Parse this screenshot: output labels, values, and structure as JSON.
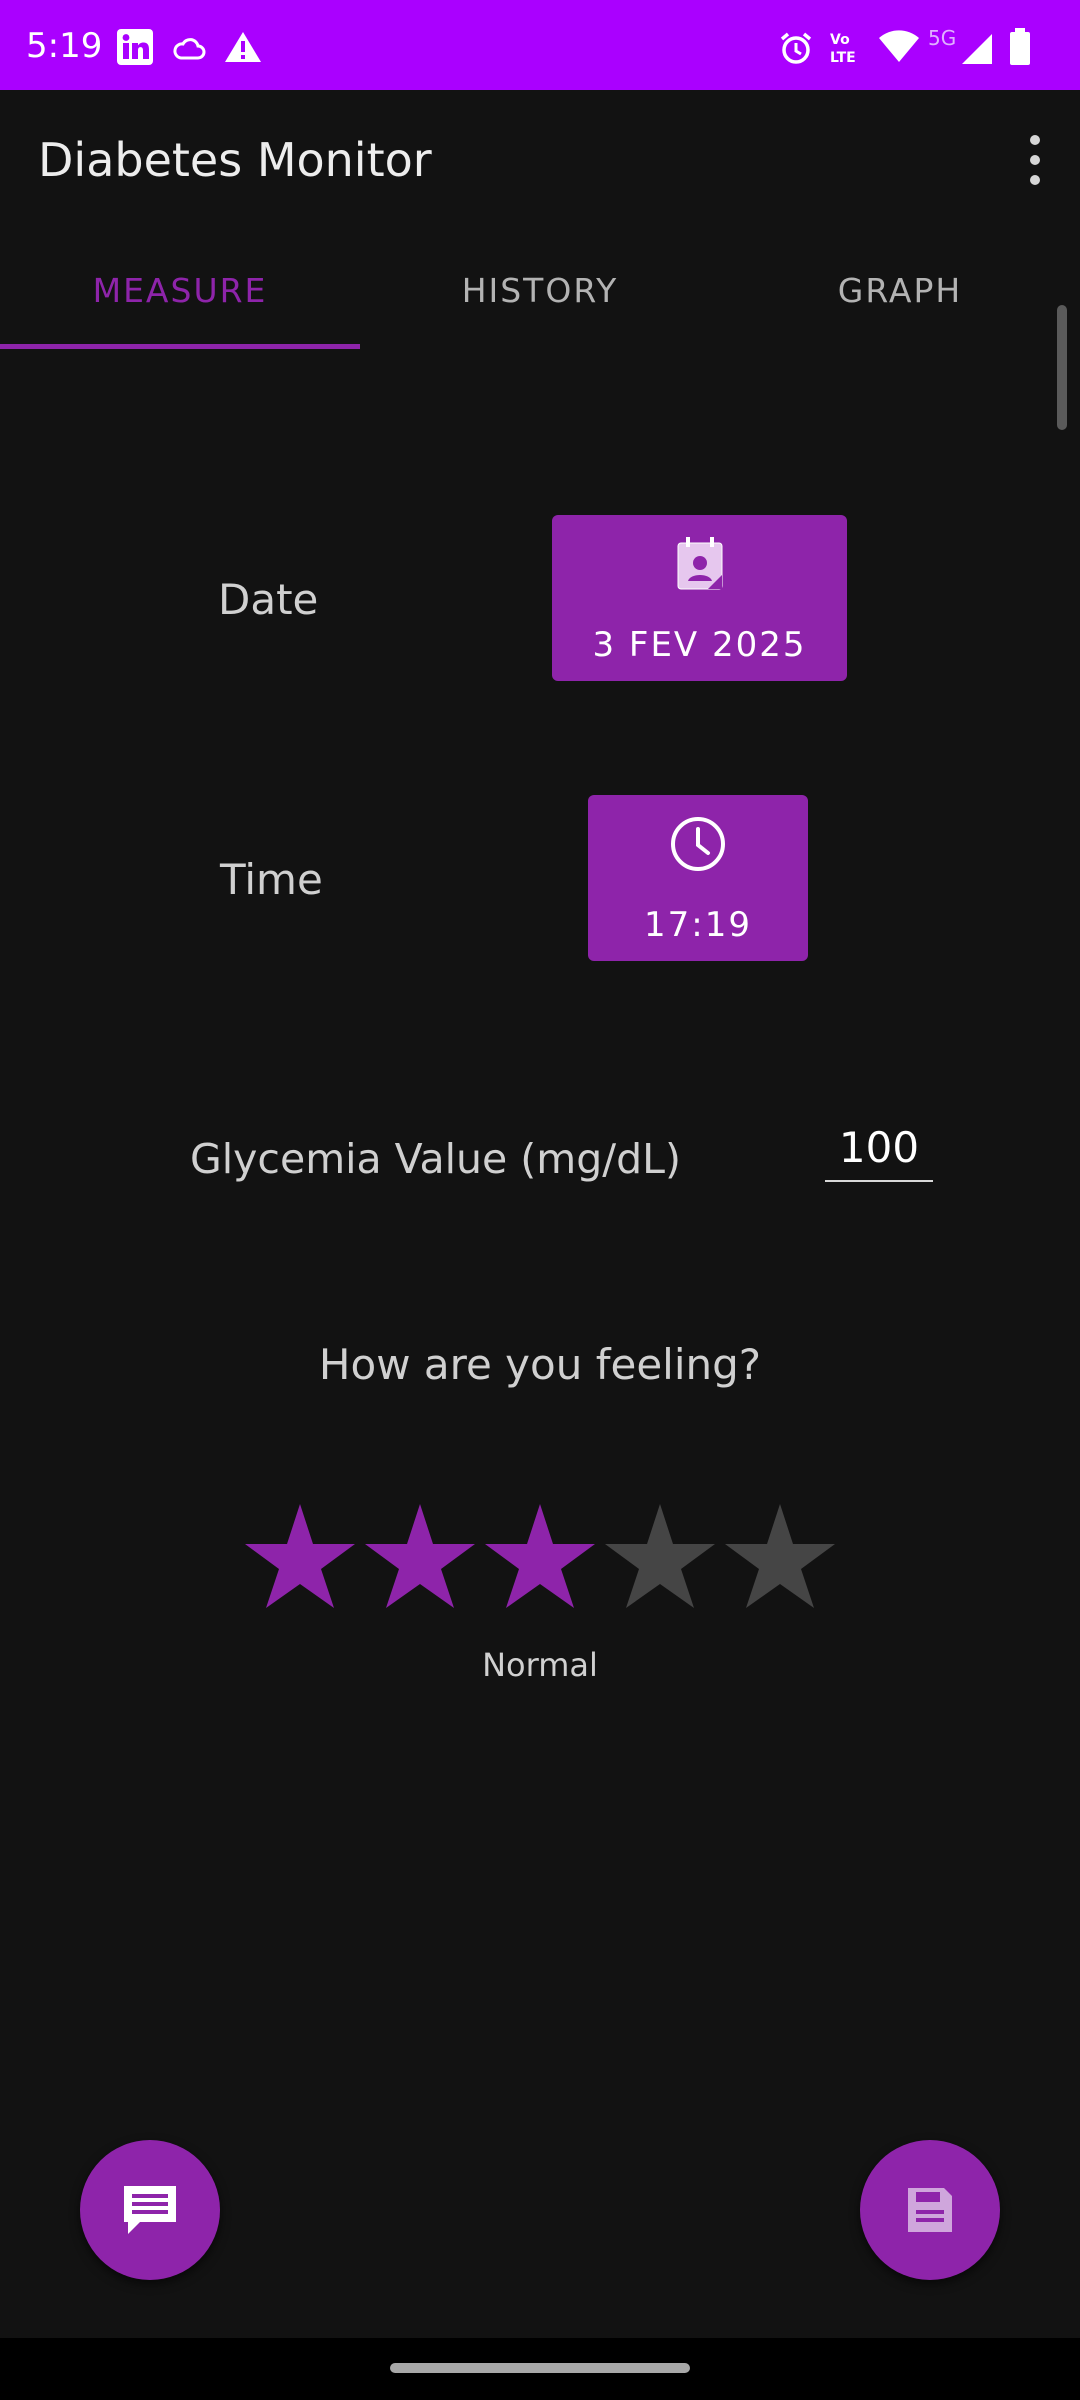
{
  "status_bar": {
    "time": "5:19",
    "network_label": "5G",
    "icons": [
      "linkedin-icon",
      "cloud-icon",
      "warning-icon",
      "alarm-icon",
      "volte-icon",
      "wifi-icon",
      "signal-icon",
      "battery-icon"
    ],
    "background_color": "#aa00ff"
  },
  "app_bar": {
    "title": "Diabetes Monitor",
    "menu_icon": "more-vert-icon"
  },
  "tabs": [
    {
      "label": "MEASURE",
      "active": true
    },
    {
      "label": "HISTORY",
      "active": false
    },
    {
      "label": "GRAPH",
      "active": false
    }
  ],
  "measure": {
    "date_label": "Date",
    "date_value": "3 FEV 2025",
    "date_icon": "calendar-icon",
    "time_label": "Time",
    "time_value": "17:19",
    "time_icon": "clock-icon",
    "glycemia_label": "Glycemia Value (mg/dL)",
    "glycemia_value": "100",
    "feeling_question": "How are you feeling?",
    "rating": 3,
    "rating_max": 5,
    "rating_text": "Normal"
  },
  "fabs": {
    "comment_icon": "comment-icon",
    "save_icon": "save-icon"
  },
  "colors": {
    "accent": "#8e24aa",
    "background": "#121212",
    "star_inactive": "#454545"
  }
}
